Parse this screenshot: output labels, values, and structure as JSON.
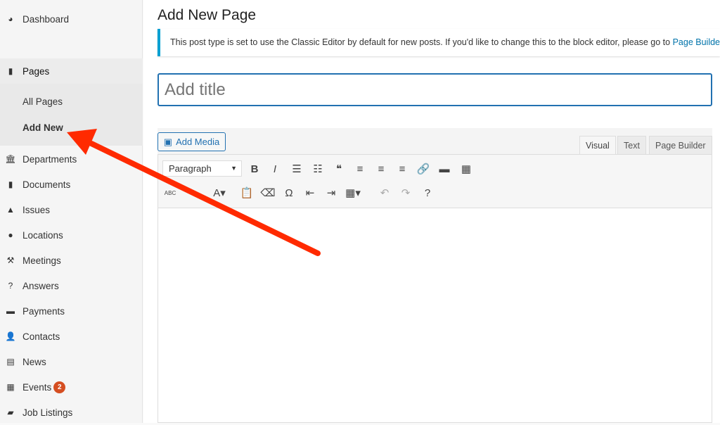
{
  "sidebar": {
    "dashboard": "Dashboard",
    "pages": "Pages",
    "sub": [
      "All Pages",
      "Add New"
    ],
    "items": [
      {
        "label": "Departments",
        "icon": "institution-icon"
      },
      {
        "label": "Documents",
        "icon": "document-icon"
      },
      {
        "label": "Issues",
        "icon": "warning-icon"
      },
      {
        "label": "Locations",
        "icon": "map-pin-icon"
      },
      {
        "label": "Meetings",
        "icon": "gavel-icon"
      },
      {
        "label": "Answers",
        "icon": "question-icon"
      },
      {
        "label": "Payments",
        "icon": "credit-card-icon"
      },
      {
        "label": "Contacts",
        "icon": "person-icon"
      },
      {
        "label": "News",
        "icon": "newspaper-icon"
      },
      {
        "label": "Events",
        "icon": "calendar-icon",
        "badge": "2"
      },
      {
        "label": "Job Listings",
        "icon": "briefcase-icon"
      }
    ]
  },
  "main": {
    "title": "Add New Page",
    "notice": "This post type is set to use the Classic Editor by default for new posts. If you'd like to change this to the block editor, please go to ",
    "notice_link": "Page Builder Settings",
    "title_placeholder": "Add title",
    "add_media": "Add Media",
    "tabs": [
      "Visual",
      "Text",
      "Page Builder"
    ],
    "format_select": "Paragraph"
  },
  "colors": {
    "accent": "#2271b1",
    "arrow": "#ff2a00",
    "badge": "#d54e21"
  }
}
